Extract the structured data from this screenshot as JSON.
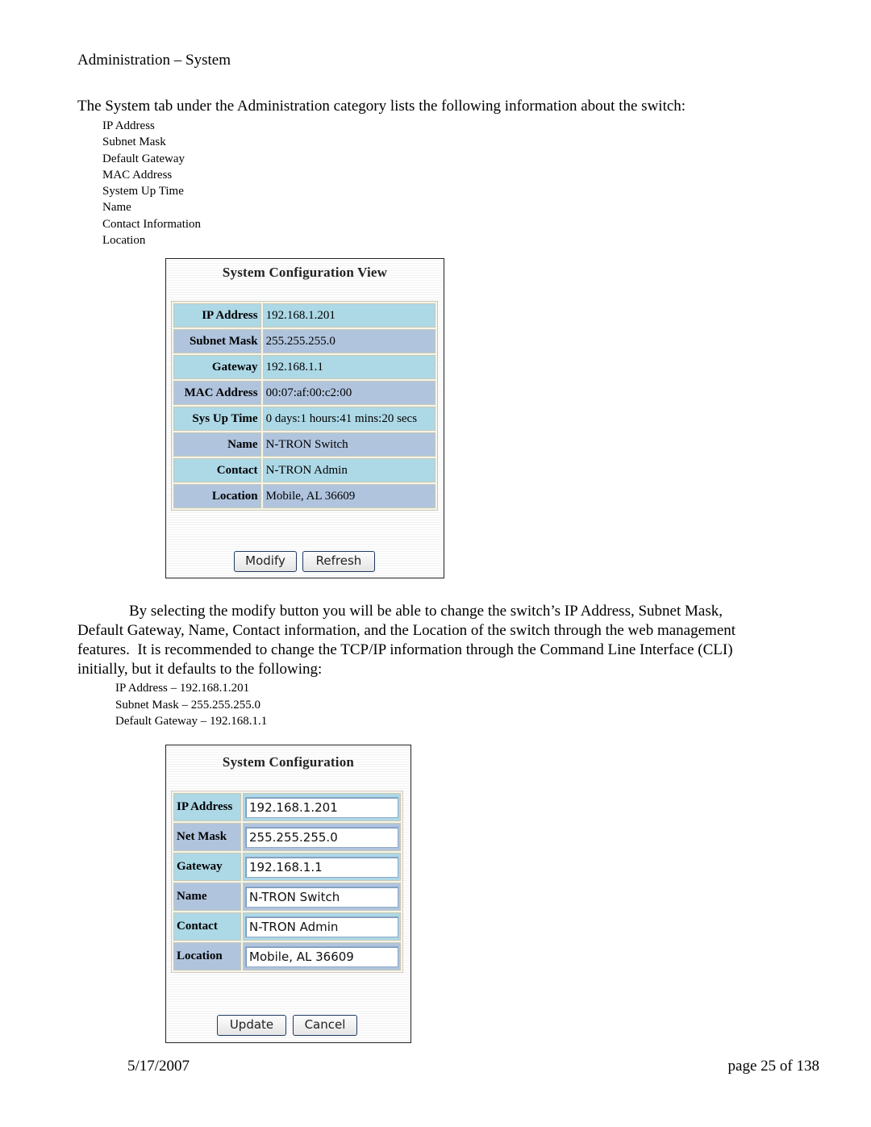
{
  "heading": "Administration – System",
  "intro": "The System tab under the Administration category lists the following information about the switch:",
  "info_list": [
    "IP Address",
    "Subnet Mask",
    "Default Gateway",
    "MAC Address",
    "System Up Time",
    "Name",
    "Contact Information",
    "Location"
  ],
  "view_panel": {
    "title": "System Configuration View",
    "rows": [
      {
        "label": "IP Address",
        "value": "192.168.1.201"
      },
      {
        "label": "Subnet Mask",
        "value": "255.255.255.0"
      },
      {
        "label": "Gateway",
        "value": "192.168.1.1"
      },
      {
        "label": "MAC Address",
        "value": "00:07:af:00:c2:00"
      },
      {
        "label": "Sys Up Time",
        "value": "0 days:1 hours:41 mins:20 secs"
      },
      {
        "label": "Name",
        "value": "N-TRON Switch"
      },
      {
        "label": "Contact",
        "value": "N-TRON Admin"
      },
      {
        "label": "Location",
        "value": "Mobile, AL 36609"
      }
    ],
    "buttons": {
      "modify": "Modify",
      "refresh": "Refresh"
    }
  },
  "paragraph": {
    "line1": "By selecting the modify button you will be able to change the switch’s IP Address, Subnet Mask,",
    "line2": "Default Gateway, Name, Contact information, and the Location of the switch through the web management",
    "line3": "features.  It is recommended to change the TCP/IP information through the Command Line Interface (CLI)",
    "line4": "initially, but it defaults to the following:"
  },
  "defaults": [
    "IP Address – 192.168.1.201",
    "Subnet Mask – 255.255.255.0",
    "Default Gateway – 192.168.1.1"
  ],
  "config_panel": {
    "title": "System Configuration",
    "rows": [
      {
        "label": "IP Address",
        "value": "192.168.1.201"
      },
      {
        "label": "Net Mask",
        "value": "255.255.255.0"
      },
      {
        "label": "Gateway",
        "value": "192.168.1.1"
      },
      {
        "label": "Name",
        "value": "N-TRON Switch"
      },
      {
        "label": "Contact",
        "value": "N-TRON Admin"
      },
      {
        "label": "Location",
        "value": "Mobile, AL 36609"
      }
    ],
    "buttons": {
      "update": "Update",
      "cancel": "Cancel"
    }
  },
  "footer": {
    "date": "5/17/2007",
    "page": "page 25 of 138"
  },
  "colors": {
    "row_light": "#add8e6",
    "row_dark": "#b0c4de"
  }
}
